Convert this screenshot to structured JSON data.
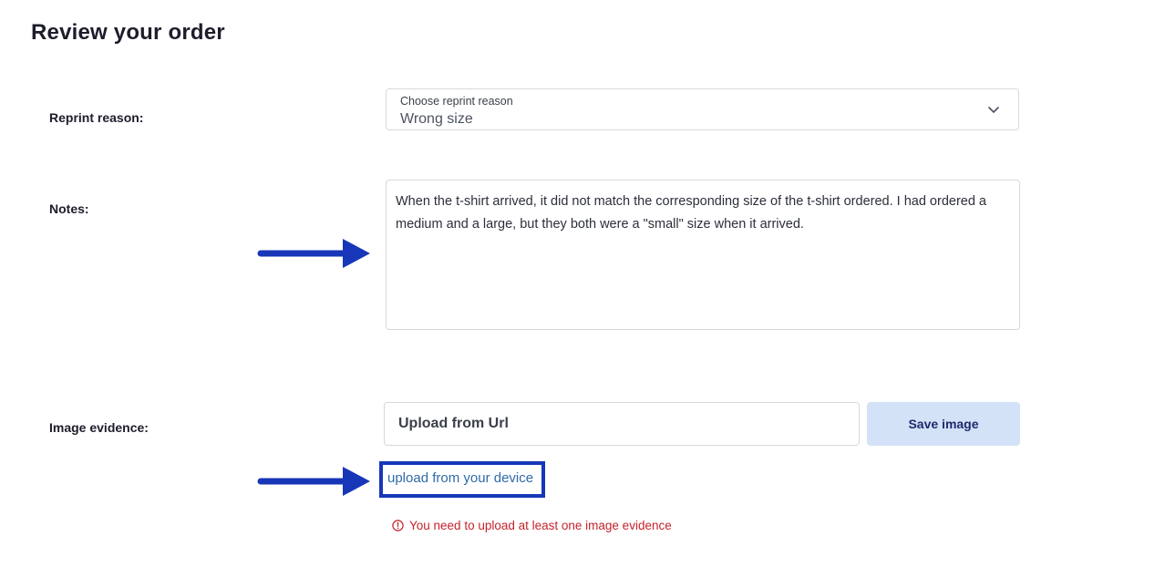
{
  "page": {
    "title": "Review your order"
  },
  "reprint": {
    "label": "Reprint reason:",
    "caption": "Choose reprint reason",
    "value": "Wrong size",
    "icon": "chevron-down-icon"
  },
  "notes": {
    "label": "Notes:",
    "value": "When the t-shirt arrived, it did not match the corresponding size of the t-shirt ordered. I had ordered a medium and a large, but they both were a \"small\" size when it arrived."
  },
  "evidence": {
    "label": "Image evidence:",
    "url_placeholder": "Upload from Url",
    "save_label": "Save image",
    "device_link": "upload from your device",
    "error": "You need to upload at least one image evidence",
    "error_icon": "alert-circle-icon"
  },
  "colors": {
    "annotation": "#1737b8",
    "error": "#c4232b",
    "button_bg": "#d4e2f7",
    "link": "#2f6aa8"
  }
}
